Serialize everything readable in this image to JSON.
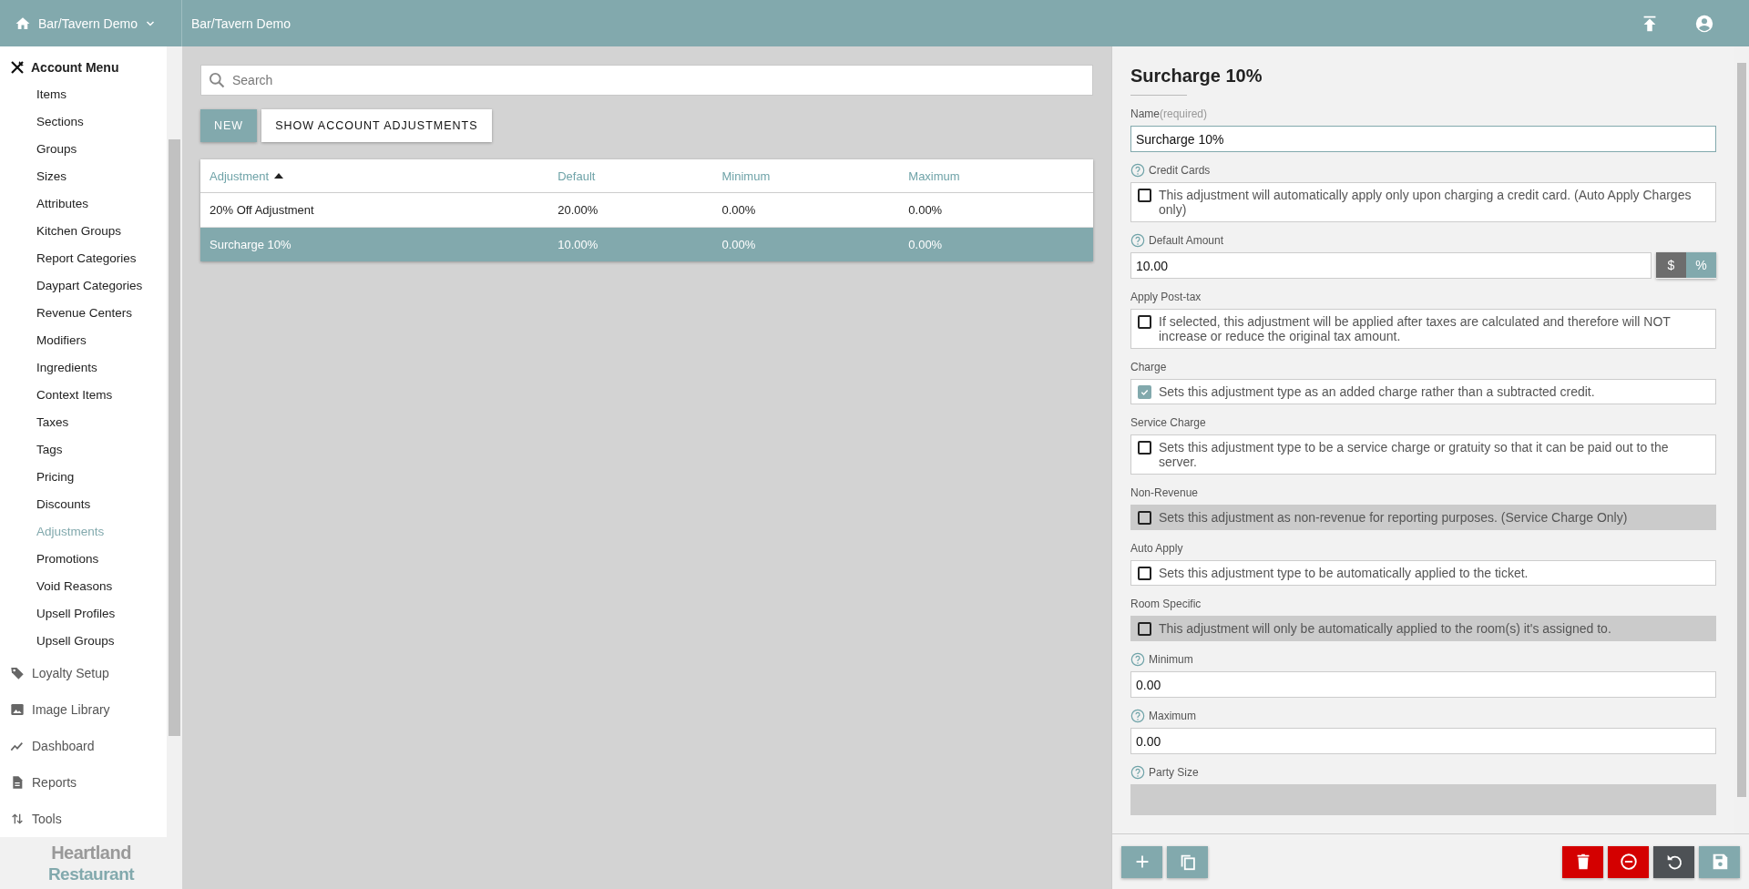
{
  "header": {
    "account": "Bar/Tavern Demo",
    "breadcrumb": "Bar/Tavern Demo"
  },
  "sidebar": {
    "section": "Account Menu",
    "items": [
      {
        "label": "Items",
        "selected": false
      },
      {
        "label": "Sections",
        "selected": false
      },
      {
        "label": "Groups",
        "selected": false
      },
      {
        "label": "Sizes",
        "selected": false
      },
      {
        "label": "Attributes",
        "selected": false
      },
      {
        "label": "Kitchen Groups",
        "selected": false
      },
      {
        "label": "Report Categories",
        "selected": false
      },
      {
        "label": "Daypart Categories",
        "selected": false
      },
      {
        "label": "Revenue Centers",
        "selected": false
      },
      {
        "label": "Modifiers",
        "selected": false
      },
      {
        "label": "Ingredients",
        "selected": false
      },
      {
        "label": "Context Items",
        "selected": false
      },
      {
        "label": "Taxes",
        "selected": false
      },
      {
        "label": "Tags",
        "selected": false
      },
      {
        "label": "Pricing",
        "selected": false
      },
      {
        "label": "Discounts",
        "selected": false
      },
      {
        "label": "Adjustments",
        "selected": true
      },
      {
        "label": "Promotions",
        "selected": false
      },
      {
        "label": "Void Reasons",
        "selected": false
      },
      {
        "label": "Upsell Profiles",
        "selected": false
      },
      {
        "label": "Upsell Groups",
        "selected": false
      }
    ],
    "links": [
      {
        "label": "Loyalty Setup",
        "kind": "tag"
      },
      {
        "label": "Image Library",
        "kind": "image"
      },
      {
        "label": "Dashboard",
        "kind": "chart"
      },
      {
        "label": "Reports",
        "kind": "document"
      },
      {
        "label": "Tools",
        "kind": "tools"
      }
    ],
    "logo": [
      "Heartland",
      "Restaurant"
    ]
  },
  "search": {
    "placeholder": "Search"
  },
  "buttons": [
    {
      "label": "NEW",
      "kind": "primary"
    },
    {
      "label": "SHOW ACCOUNT ADJUSTMENTS",
      "kind": "plain"
    }
  ],
  "table": {
    "columns": [
      {
        "label": "Adjustment",
        "sorted": true
      },
      {
        "label": "Default",
        "sorted": false
      },
      {
        "label": "Minimum",
        "sorted": false
      },
      {
        "label": "Maximum",
        "sorted": false
      }
    ],
    "rows": [
      {
        "cells": [
          "20% Off Adjustment",
          "20.00%",
          "0.00%",
          "0.00%"
        ],
        "selected": false
      },
      {
        "cells": [
          "Surcharge 10%",
          "10.00%",
          "0.00%",
          "0.00%"
        ],
        "selected": true
      }
    ]
  },
  "detail": {
    "title": "Surcharge 10%",
    "fields": [
      {
        "kind": "text",
        "label": "Name",
        "note": "(required)",
        "help": false,
        "value": "Surcharge 10%"
      },
      {
        "kind": "checkbox",
        "label": "Credit Cards",
        "help": true,
        "text": "This adjustment will automatically apply only upon charging a credit card. (Auto Apply Charges only)",
        "checked": false,
        "disabled": false
      },
      {
        "kind": "amount",
        "label": "Default Amount",
        "help": true,
        "value": "10.00",
        "units": [
          {
            "label": "$",
            "selected": false
          },
          {
            "label": "%",
            "selected": true
          }
        ]
      },
      {
        "kind": "checkbox",
        "label": "Apply Post-tax",
        "help": false,
        "text": "If selected, this adjustment will be applied after taxes are calculated and therefore will NOT increase or reduce the original tax amount.",
        "checked": false,
        "disabled": false
      },
      {
        "kind": "checkbox",
        "label": "Charge",
        "help": false,
        "text": "Sets this adjustment type as an added charge rather than a subtracted credit.",
        "checked": true,
        "disabled": false
      },
      {
        "kind": "checkbox",
        "label": "Service Charge",
        "help": false,
        "text": "Sets this adjustment type to be a service charge or gratuity so that it can be paid out to the server.",
        "checked": false,
        "disabled": false
      },
      {
        "kind": "checkbox",
        "label": "Non-Revenue",
        "help": false,
        "text": "Sets this adjustment as non-revenue for reporting purposes. (Service Charge Only)",
        "checked": false,
        "disabled": true
      },
      {
        "kind": "checkbox",
        "label": "Auto Apply",
        "help": false,
        "text": "Sets this adjustment type to be automatically applied to the ticket.",
        "checked": false,
        "disabled": false
      },
      {
        "kind": "checkbox",
        "label": "Room Specific",
        "help": false,
        "text": "This adjustment will only be automatically applied to the room(s) it's assigned to.",
        "checked": false,
        "disabled": true
      },
      {
        "kind": "text",
        "label": "Minimum",
        "help": true,
        "value": "0.00"
      },
      {
        "kind": "text",
        "label": "Maximum",
        "help": true,
        "value": "0.00"
      },
      {
        "kind": "text",
        "label": "Party Size",
        "help": true,
        "disabled": true
      }
    ]
  },
  "actions": [
    {
      "kind": "add"
    },
    {
      "kind": "copy"
    },
    {
      "kind": "delete"
    },
    {
      "kind": "cancel"
    },
    {
      "kind": "undo"
    },
    {
      "kind": "save"
    }
  ]
}
